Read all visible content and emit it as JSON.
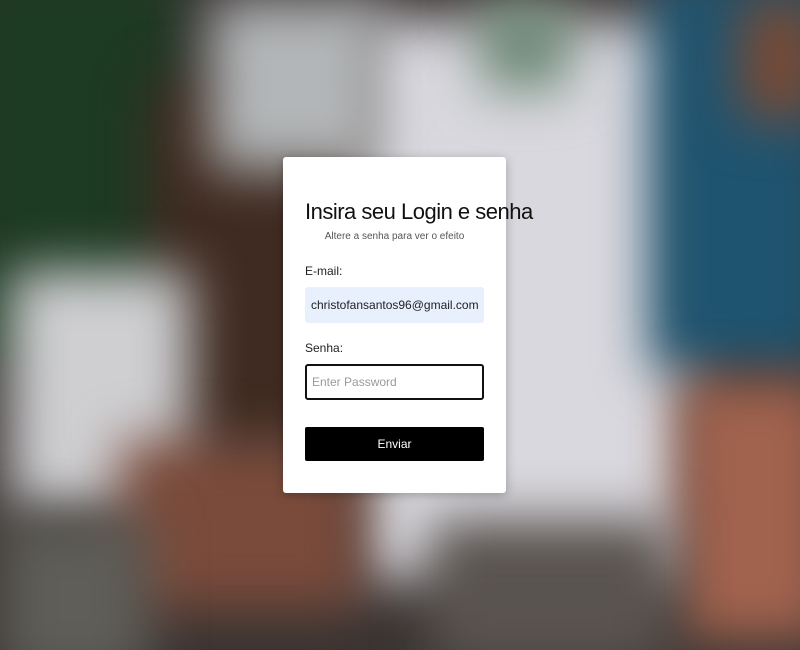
{
  "login_card": {
    "title": "Insira seu Login e senha",
    "subtitle": "Altere a senha para ver o efeito",
    "email": {
      "label": "E-mail:",
      "value": "christofansantos96@gmail.com"
    },
    "password": {
      "label": "Senha:",
      "value": "",
      "placeholder": "Enter Password"
    },
    "submit_label": "Enviar"
  },
  "colors": {
    "card_background": "#ffffff",
    "email_field_background": "#e8f0fe",
    "button_background": "#000000",
    "button_text": "#ffffff"
  }
}
